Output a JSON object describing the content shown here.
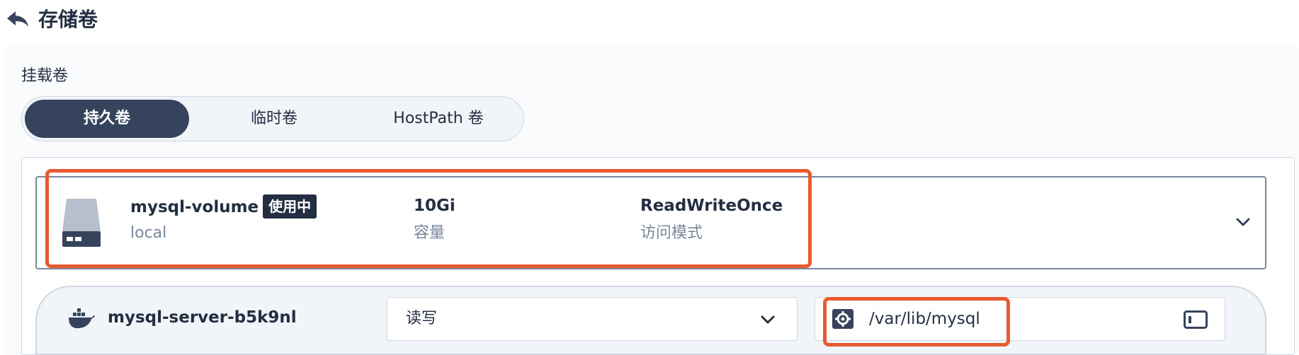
{
  "header": {
    "title": "存储卷"
  },
  "panel": {
    "section_label": "挂载卷",
    "tabs": [
      {
        "label": "持久卷",
        "active": true
      },
      {
        "label": "临时卷",
        "active": false
      },
      {
        "label": "HostPath 卷",
        "active": false
      }
    ]
  },
  "volume": {
    "name": "mysql-volume",
    "status": "使用中",
    "storage_class": "local",
    "capacity": "10Gi",
    "capacity_label": "容量",
    "access_mode": "ReadWriteOnce",
    "access_mode_label": "访问模式"
  },
  "mount": {
    "container_name": "mysql-server-b5k9nl",
    "mode": "读写",
    "path": "/var/lib/mysql"
  },
  "colors": {
    "accent_dark": "#36435c",
    "text_primary": "#242e42",
    "text_secondary": "#79879c",
    "highlight": "#e85a2f"
  }
}
